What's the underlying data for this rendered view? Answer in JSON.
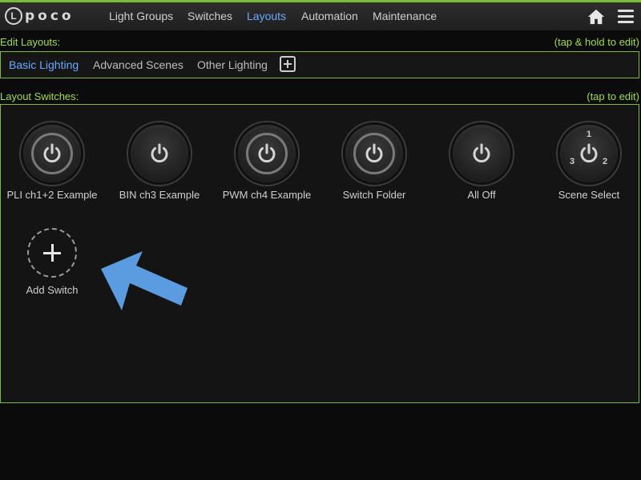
{
  "app": {
    "logo_mark": "L",
    "logo_text": "poco"
  },
  "nav": {
    "items": [
      {
        "label": "Light Groups",
        "active": false
      },
      {
        "label": "Switches",
        "active": false
      },
      {
        "label": "Layouts",
        "active": true
      },
      {
        "label": "Automation",
        "active": false
      },
      {
        "label": "Maintenance",
        "active": false
      }
    ],
    "icons": [
      "home-icon",
      "hamburger-menu-icon"
    ]
  },
  "edit_layouts": {
    "title": "Edit Layouts:",
    "hint": "(tap & hold to edit)",
    "tabs": [
      {
        "label": "Basic Lighting",
        "active": true
      },
      {
        "label": "Advanced Scenes",
        "active": false
      },
      {
        "label": "Other Lighting",
        "active": false
      }
    ],
    "add_icon": "plus-square-icon"
  },
  "layout_switches": {
    "title": "Layout Switches:",
    "hint": "(tap to edit)",
    "switches": [
      {
        "label": "PLI ch1+2 Example",
        "icon": "power-icon",
        "ring": true
      },
      {
        "label": "BIN ch3 Example",
        "icon": "power-icon",
        "ring": false
      },
      {
        "label": "PWM ch4 Example",
        "icon": "power-icon",
        "ring": true
      },
      {
        "label": "Switch Folder",
        "icon": "power-icon",
        "ring": true
      },
      {
        "label": "All Off",
        "icon": "power-icon",
        "ring": false
      },
      {
        "label": "Scene Select",
        "icon": "power-icon",
        "ring": false,
        "scene_numbers": [
          "1",
          "2",
          "3"
        ]
      }
    ],
    "add_switch_label": "Add Switch"
  },
  "colors": {
    "accent_green": "#9fdc4a",
    "active_blue": "#6aa9ff",
    "arrow_blue": "#5b9be0",
    "background": "#0b0b0b"
  }
}
